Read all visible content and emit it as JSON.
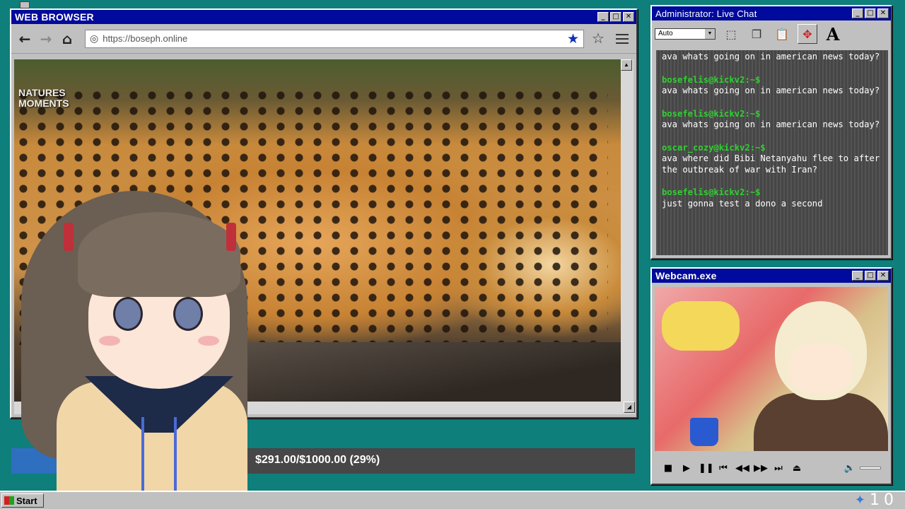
{
  "browser": {
    "title": "WEB BROWSER",
    "url": "https://boseph.online",
    "video_watermark": "NATURES\nMOMENTS",
    "window_buttons": [
      "_",
      "□",
      "✕"
    ]
  },
  "donation": {
    "label": "$291.00/$1000.00 (29%)",
    "progress_fraction": 0.29,
    "fill_color": "#2f6fc0"
  },
  "chat": {
    "title": "Administrator: Live Chat",
    "select_value": "Auto",
    "messages": [
      {
        "user": "",
        "text": "ava whats going on in american news today?"
      },
      {
        "user": "bosefelis@kickv2:~$",
        "text": "ava whats going on in american news today?"
      },
      {
        "user": "bosefelis@kickv2:~$",
        "text": "ava whats going on in american news today?"
      },
      {
        "user": "oscar_cozy@kickv2:~$",
        "text": "ava where did Bibi Netanyahu flee to after the outbreak of war with Iran?"
      },
      {
        "user": "bosefelis@kickv2:~$",
        "text": "just gonna test a dono a second"
      }
    ],
    "user_color": "#2fd12f"
  },
  "webcam": {
    "title": "Webcam.exe"
  },
  "taskbar": {
    "start_label": "Start",
    "clock_text": "10"
  },
  "colors": {
    "desktop": "#0e7f7a",
    "titlebar": "#000a9c",
    "chrome": "#c0c0c0"
  },
  "icons": [
    "back-arrow-icon",
    "forward-arrow-icon",
    "home-icon",
    "globe-icon",
    "bookmark-star-icon",
    "star-outline-icon",
    "hamburger-menu-icon",
    "select-tool-icon",
    "copy-icon",
    "paste-icon",
    "move-icon",
    "font-icon",
    "stop-icon",
    "play-icon",
    "pause-icon",
    "skip-back-icon",
    "rewind-icon",
    "fast-forward-icon",
    "skip-forward-icon",
    "eject-icon",
    "volume-icon"
  ]
}
